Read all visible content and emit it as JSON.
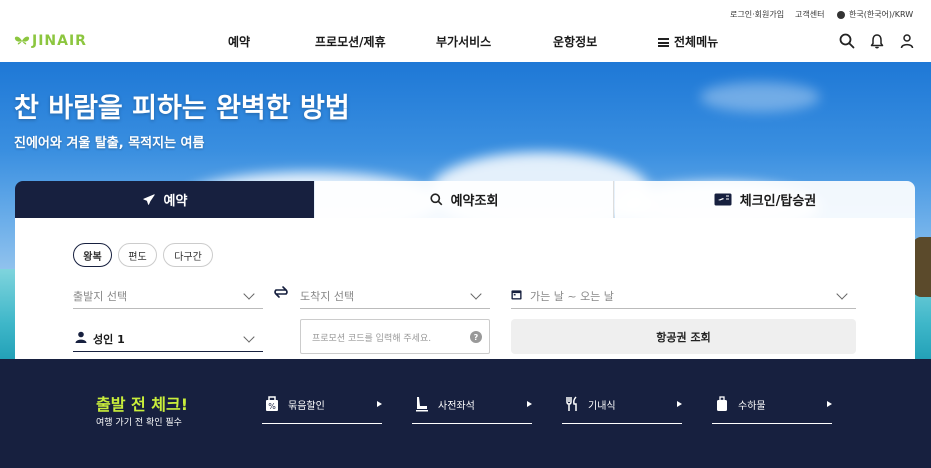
{
  "utility": {
    "login": "로그인·회원가입",
    "support": "고객센터",
    "language": "한국(한국어)/KRW"
  },
  "header": {
    "logo": "JINAIR",
    "nav": [
      "예약",
      "프로모션/제휴",
      "부가서비스",
      "운항정보",
      "전체메뉴"
    ]
  },
  "hero": {
    "title": "찬 바람을 피하는 완벽한 방법",
    "subtitle": "진에어와 겨울 탈출, 목적지는 여름"
  },
  "booking": {
    "tabs": [
      "예약",
      "예약조회",
      "체크인/탑승권"
    ],
    "trip_types": [
      "왕복",
      "편도",
      "다구간"
    ],
    "selected_trip_type": "왕복",
    "departure_placeholder": "출발지 선택",
    "arrival_placeholder": "도착지 선택",
    "date_placeholder": "가는 날 ~ 오는 날",
    "passengers": "성인 1",
    "promo_placeholder": "프로모션 코드를 입력해 주세요.",
    "search_button": "항공권 조회"
  },
  "pre_check": {
    "title": "출발 전 체크!",
    "subtitle": "여행 가기 전 확인 필수",
    "items": [
      {
        "label": "묶음할인",
        "icon": "bundle-discount-icon"
      },
      {
        "label": "사전좌석",
        "icon": "seat-icon"
      },
      {
        "label": "기내식",
        "icon": "meal-icon"
      },
      {
        "label": "수하물",
        "icon": "baggage-icon"
      }
    ]
  },
  "colors": {
    "brand_green": "#8cc63f",
    "navy": "#17203f",
    "highlight_lime": "#c9ee3b"
  }
}
